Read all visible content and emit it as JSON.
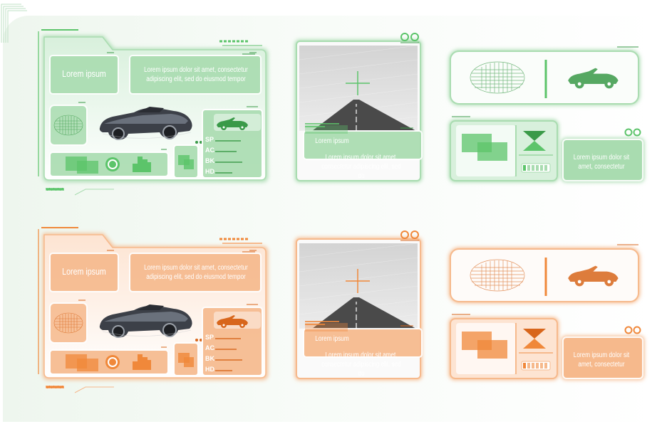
{
  "themes": [
    {
      "id": "green",
      "accent": "#5cc46a",
      "light": "#d8f0dc",
      "mid": "#a9dcb0",
      "dark": "#3a9a48",
      "headline": "Lorem ipsum",
      "paragraph": "Lorem ipsum dolor sit amet, consectetur adipiscing elit, sed do eiusmod tempor",
      "stats": [
        "SP",
        "AC",
        "BK",
        "HD"
      ],
      "road_label": "Lorem ipsum",
      "road_caption": "Lorem ipsum dolor sit amet, consectetur adipiscing elit, sed do",
      "small_caption": "Lorem ipsum dolor sit amet, consectetur"
    },
    {
      "id": "orange",
      "accent": "#f0883a",
      "light": "#fde4d2",
      "mid": "#f6b98c",
      "dark": "#d8661c",
      "headline": "Lorem ipsum",
      "paragraph": "Lorem ipsum dolor sit amet, consectetur adipiscing elit, sed do eiusmod tempor",
      "stats": [
        "SP",
        "AC",
        "BK",
        "HD"
      ],
      "road_label": "Lorem ipsum",
      "road_caption": "Lorem ipsum dolor sit amet, consectetur adipiscing elit, sed do",
      "small_caption": "Lorem ipsum dolor sit amet, consectetur"
    }
  ],
  "icons": [
    "crosshair-icon",
    "grid-target-icon",
    "convertible-car-icon",
    "hourglass-icon",
    "battery-icon",
    "circle-indicator-icon",
    "bar-equalizer-icon"
  ]
}
